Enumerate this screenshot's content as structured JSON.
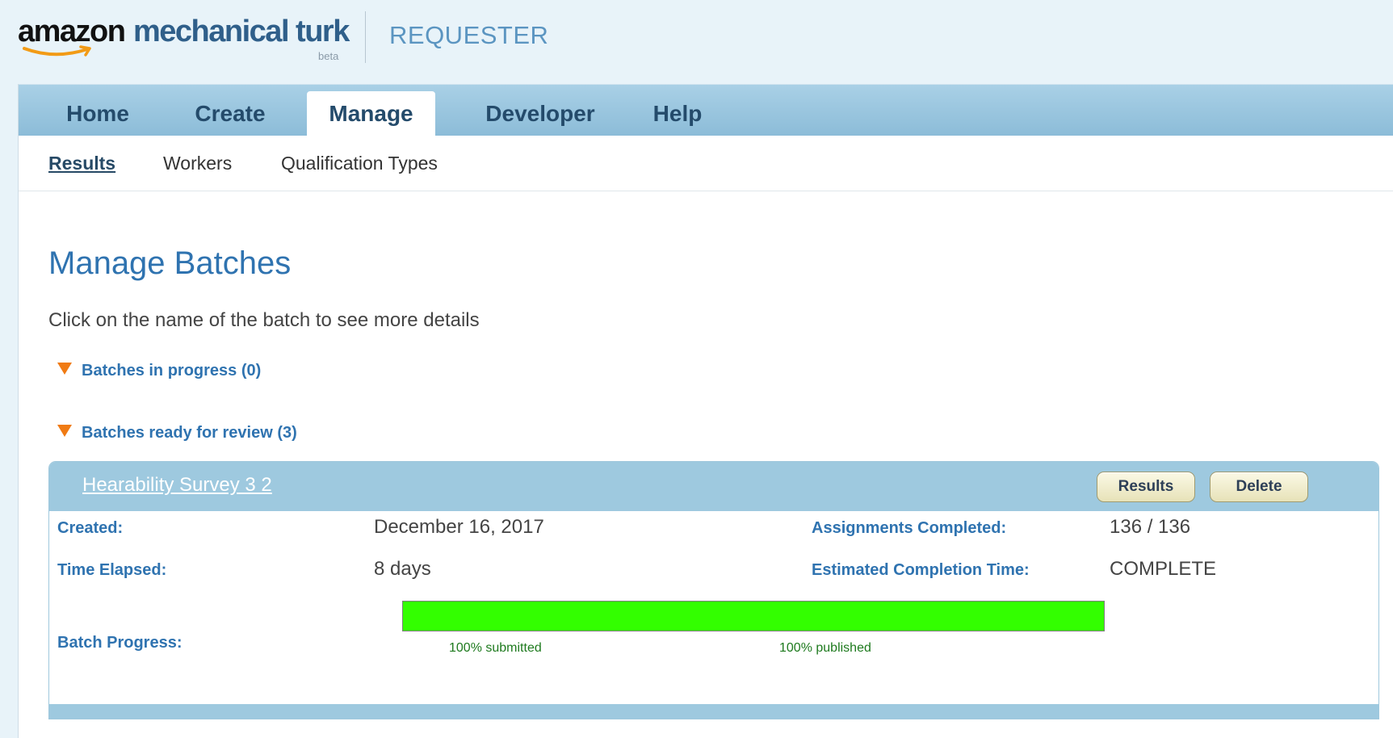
{
  "header": {
    "logo_amazon": "amazon",
    "logo_mturk": "mechanical turk",
    "logo_beta": "beta",
    "section": "REQUESTER"
  },
  "tabs": [
    {
      "label": "Home",
      "active": false
    },
    {
      "label": "Create",
      "active": false
    },
    {
      "label": "Manage",
      "active": true
    },
    {
      "label": "Developer",
      "active": false
    },
    {
      "label": "Help",
      "active": false
    }
  ],
  "subnav": [
    {
      "label": "Results",
      "active": true
    },
    {
      "label": "Workers",
      "active": false
    },
    {
      "label": "Qualification Types",
      "active": false
    }
  ],
  "page": {
    "title": "Manage Batches",
    "instructions": "Click on the name of the batch to see more details"
  },
  "sections": {
    "in_progress": "Batches in progress (0)",
    "ready_for_review": "Batches ready for review (3)"
  },
  "batch": {
    "name": "Hearability Survey 3 2",
    "results_button": "Results",
    "delete_button": "Delete",
    "created_label": "Created:",
    "created_value": "December 16, 2017",
    "elapsed_label": "Time Elapsed:",
    "elapsed_value": "8 days",
    "assignments_label": "Assignments Completed:",
    "assignments_value": "136 / 136",
    "eta_label": "Estimated Completion Time:",
    "eta_value": "COMPLETE",
    "progress_label": "Batch Progress:",
    "progress_fraction": 1.0,
    "submitted_text": "100% submitted",
    "published_text": "100% published"
  },
  "colors": {
    "accent_blue": "#2f73b0",
    "tab_bar": "#9ec9df",
    "progress_green": "#33ff00",
    "section_arrow": "#f07b14"
  },
  "icons": {
    "section_toggle": "triangle-down-icon",
    "logo_smile": "amazon-smile-arrow-icon"
  }
}
